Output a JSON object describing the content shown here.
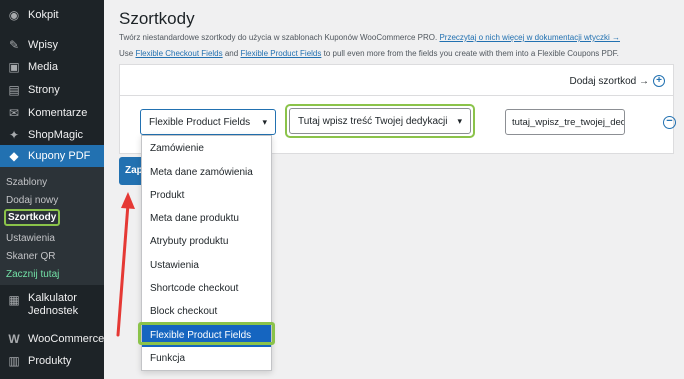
{
  "sidebar": {
    "items": [
      {
        "label": "Kokpit",
        "icon": "dashboard-icon",
        "glyph": "◉"
      },
      {
        "label": "Wpisy",
        "icon": "pin-icon",
        "glyph": "✎"
      },
      {
        "label": "Media",
        "icon": "media-icon",
        "glyph": "▣"
      },
      {
        "label": "Strony",
        "icon": "pages-icon",
        "glyph": "▤"
      },
      {
        "label": "Komentarze",
        "icon": "comment-icon",
        "glyph": "✉"
      },
      {
        "label": "ShopMagic",
        "icon": "magic-wand-icon",
        "glyph": "✦"
      },
      {
        "label": "Kupony PDF",
        "icon": "tag-icon",
        "glyph": "◆"
      }
    ],
    "submenu": [
      {
        "label": "Szablony"
      },
      {
        "label": "Dodaj nowy"
      },
      {
        "label": "Szortkody"
      },
      {
        "label": "Ustawienia"
      },
      {
        "label": "Skaner QR"
      },
      {
        "label": "Zacznij tutaj"
      }
    ],
    "lower_items": [
      {
        "label": "Kalkulator Jednostek",
        "icon": "calculator-icon",
        "glyph": "▦"
      },
      {
        "label": "WooCommerce",
        "icon": "woocommerce-icon",
        "glyph": "W"
      },
      {
        "label": "Produkty",
        "icon": "products-icon",
        "glyph": "▥"
      }
    ]
  },
  "main": {
    "title": "Szortkody",
    "desc1_text": "Twórz niestandardowe szortkody do użycia w szablonach Kuponów WooCommerce PRO.",
    "desc1_link": "Przeczytaj o nich więcej w dokumentacji wtyczki →",
    "desc2_prefix": "Use",
    "desc2_link1": "Flexible Checkout Fields",
    "desc2_and": "and",
    "desc2_link2": "Flexible Product Fields",
    "desc2_suffix": "to pull even more from the fields you create with them into a Flexible Coupons PDF.",
    "add_shortcode": "Dodaj szortkod →",
    "select1_value": "Flexible Product Fields",
    "select2_value": "Tutaj wpisz treść Twojej dedykacji",
    "input_value": "tutaj_wpisz_tre_twojej_ded",
    "save_label": "Zapisz"
  },
  "dropdown": {
    "options": [
      "Zamówienie",
      "Meta dane zamówienia",
      "Produkt",
      "Meta dane produktu",
      "Atrybuty produktu",
      "Ustawienia",
      "Shortcode checkout",
      "Block checkout",
      "Flexible Product Fields",
      "Funkcja"
    ],
    "selected_index": 8
  },
  "colors": {
    "sidebar_bg": "#1d2327",
    "accent": "#2271b1",
    "highlight_green": "#8bc34a",
    "arrow_red": "#e53935"
  }
}
